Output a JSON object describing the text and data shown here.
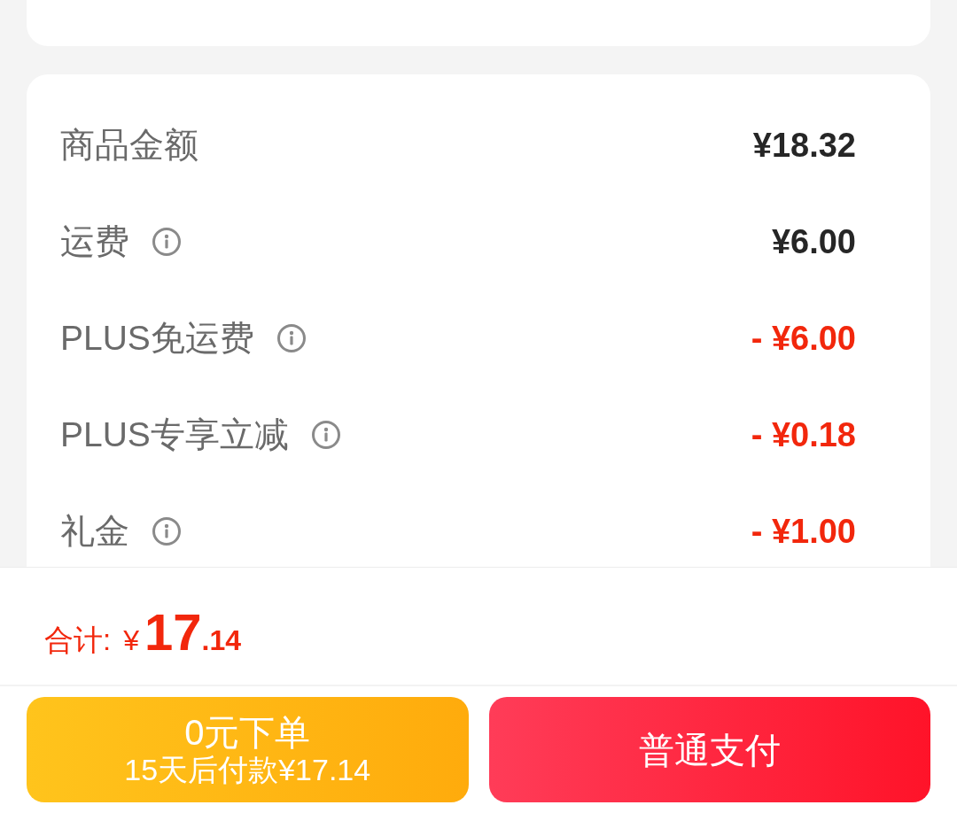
{
  "summary": {
    "rows": [
      {
        "label": "商品金额",
        "info": false,
        "amount": "¥18.32",
        "kind": "charge"
      },
      {
        "label": "运费",
        "info": true,
        "amount": "¥6.00",
        "kind": "charge"
      },
      {
        "label": "PLUS免运费",
        "info": true,
        "amount": "- ¥6.00",
        "kind": "discount"
      },
      {
        "label": "PLUS专享立减",
        "info": true,
        "amount": "- ¥0.18",
        "kind": "discount"
      },
      {
        "label": "礼金",
        "info": true,
        "amount": "- ¥1.00",
        "kind": "discount"
      }
    ]
  },
  "total": {
    "label": "合计:",
    "currency": "¥",
    "integer": "17",
    "decimal": ".14"
  },
  "buttons": [
    {
      "kind": "deferred",
      "title": "0元下单",
      "subtitle": "15天后付款¥17.14"
    },
    {
      "kind": "primary",
      "title": "普通支付"
    }
  ]
}
